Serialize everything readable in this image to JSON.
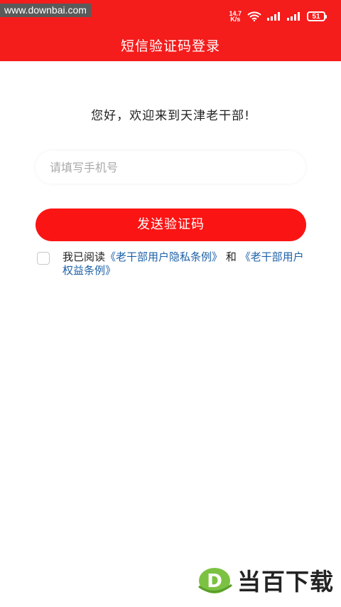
{
  "status_bar": {
    "watermark": "www.downbai.com",
    "net_speed_value": "14.7",
    "net_speed_unit": "K/s",
    "battery": "51"
  },
  "header": {
    "title": "短信验证码登录"
  },
  "main": {
    "greeting": "您好，欢迎来到天津老干部!",
    "phone_placeholder": "请填写手机号",
    "send_button": "发送验证码",
    "agreement": {
      "prefix": "我已阅读",
      "privacy_link": "《老干部用户隐私条例》",
      "and": "和",
      "rights_link": "《老干部用户权益条例》"
    }
  },
  "watermark_bottom": {
    "logo_letter": "D",
    "text": "当百下载"
  },
  "colors": {
    "header_red": "#f51c1c",
    "button_red": "#fb1414",
    "link_blue": "#1d61a8",
    "logo_green": "#7cc242"
  }
}
